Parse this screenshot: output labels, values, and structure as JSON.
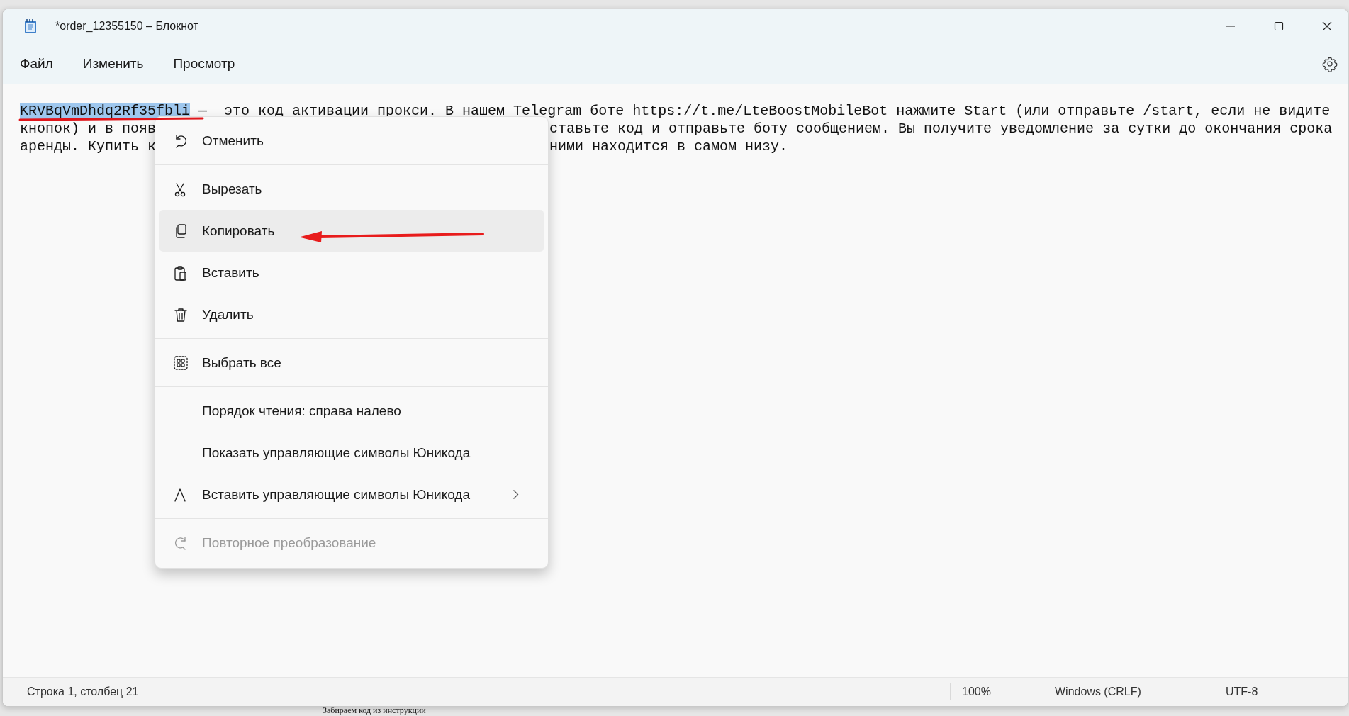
{
  "window": {
    "title": "*order_12355150 – Блокнот"
  },
  "menu_bar": [
    "Файл",
    "Изменить",
    "Просмотр"
  ],
  "editor": {
    "lines": [
      {
        "segments": [
          {
            "text": "KRVBqVmDhdq2Rf35fbli",
            "selected": true
          },
          {
            "text": " —  это код активации прокси. В нашем Telegram боте https://t.me/LteBoostMobileBot нажмите Start (или отправьте /start, если не видите",
            "selected": false
          }
        ]
      },
      {
        "segments": [
          {
            "text": "кнопок) и в появ",
            "selected": false
          },
          {
            "text": "ставьте код и отправьте боту сообщением. Вы получите уведомление за сутки до окончания срока",
            "selected": false
          }
        ]
      },
      {
        "segments": [
          {
            "text": "аренды. Купить к",
            "selected": false
          },
          {
            "text": "ними находится в самом низу.",
            "selected": false
          }
        ]
      }
    ]
  },
  "context_menu": {
    "groups": [
      [
        {
          "label": "Отменить",
          "highlighted": false,
          "disabled": false,
          "submenu": false
        }
      ],
      [
        {
          "label": "Вырезать",
          "highlighted": false,
          "disabled": false,
          "submenu": false
        },
        {
          "label": "Копировать",
          "highlighted": true,
          "disabled": false,
          "submenu": false
        },
        {
          "label": "Вставить",
          "highlighted": false,
          "disabled": false,
          "submenu": false
        },
        {
          "label": "Удалить",
          "highlighted": false,
          "disabled": false,
          "submenu": false
        }
      ],
      [
        {
          "label": "Выбрать все",
          "highlighted": false,
          "disabled": false,
          "submenu": false
        }
      ],
      [
        {
          "label": "Порядок чтения: справа налево",
          "highlighted": false,
          "disabled": false,
          "submenu": false
        },
        {
          "label": "Показать управляющие символы Юникода",
          "highlighted": false,
          "disabled": false,
          "submenu": false
        },
        {
          "label": "Вставить управляющие символы Юникода",
          "highlighted": false,
          "disabled": false,
          "submenu": true
        }
      ],
      [
        {
          "label": "Повторное преобразование",
          "highlighted": false,
          "disabled": true,
          "submenu": false
        }
      ]
    ]
  },
  "status_bar": {
    "position": "Строка 1, столбец 21",
    "zoom": "100%",
    "line_ending": "Windows (CRLF)",
    "encoding": "UTF-8"
  },
  "background_page": {
    "heading": "Забираем код из инструкции"
  }
}
